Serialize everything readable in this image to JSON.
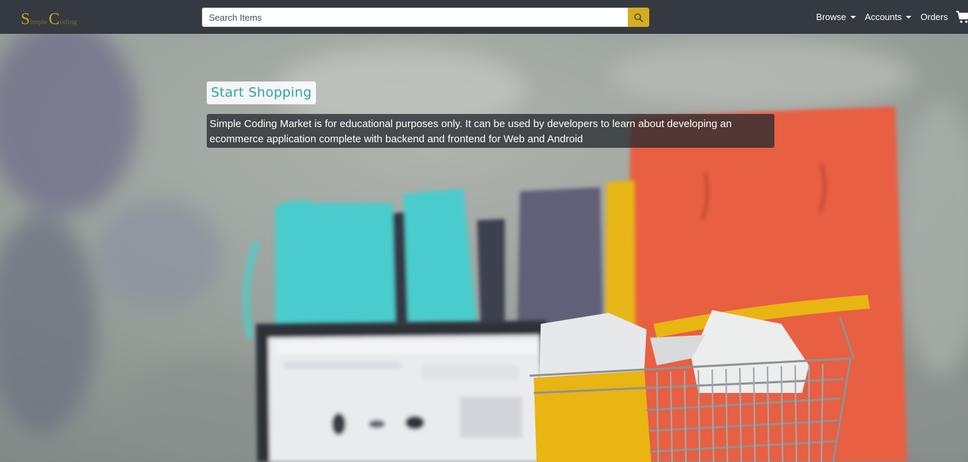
{
  "brand": {
    "letter1": "S",
    "rest1": "imple",
    "letter2": "C",
    "rest2": "oding"
  },
  "search": {
    "placeholder": "Search Items",
    "value": ""
  },
  "nav": {
    "browse_label": "Browse",
    "accounts_label": "Accounts",
    "orders_label": "Orders"
  },
  "hero": {
    "title": "Start Shopping",
    "description": "Simple Coding Market is for educational purposes only. It can be used by developers to learn about developing an ecommerce application complete with backend and frontend for Web and Android"
  },
  "colors": {
    "navbar": "#343a40",
    "accent_gold": "#d4ac22",
    "title_teal": "#2ea3a8",
    "bag_teal": "#4bcccc",
    "bag_orange": "#e85e42"
  },
  "icons": [
    "search-icon",
    "caret-down-icon",
    "shopping-cart-icon"
  ]
}
